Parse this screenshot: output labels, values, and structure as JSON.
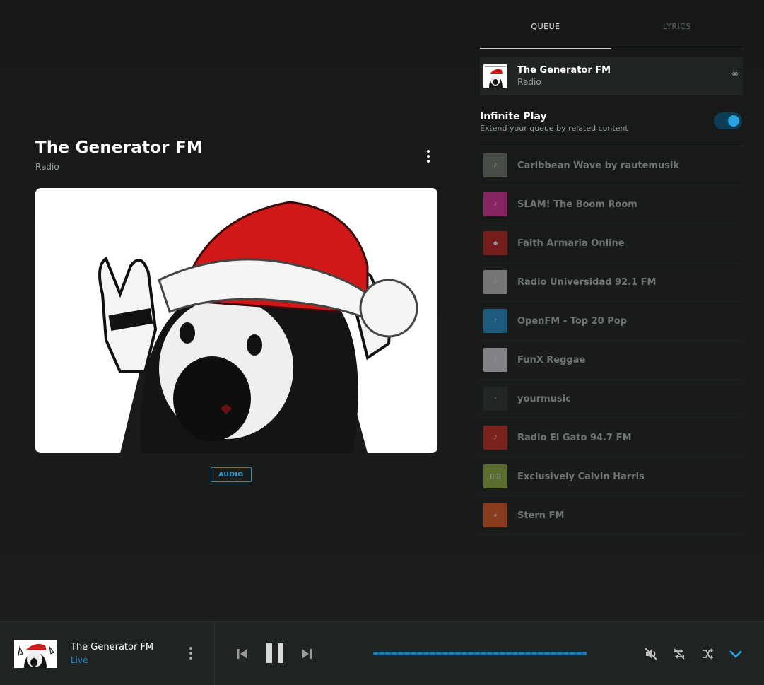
{
  "now_playing": {
    "title": "The Generator FM",
    "subtitle": "Radio",
    "media_badge": "AUDIO"
  },
  "tabs": [
    {
      "label": "QUEUE",
      "active": true
    },
    {
      "label": "LYRICS",
      "active": false
    }
  ],
  "queue_current": {
    "name": "The Generator FM",
    "type": "Radio",
    "repeat_symbol": "∞"
  },
  "infinite_play": {
    "title": "Infinite Play",
    "subtitle": "Extend your queue by related content",
    "enabled": true
  },
  "queue": [
    {
      "name": "Caribbean Wave by rautemusik",
      "thumb_color": "#6d7a6a"
    },
    {
      "name": "SLAM! The Boom Room",
      "thumb_color": "#e0309a"
    },
    {
      "name": "Faith Armaria Online",
      "thumb_color": "#c0201c"
    },
    {
      "name": "Radio Universidad 92.1 FM",
      "thumb_color": "#bfbfbf"
    },
    {
      "name": "OpenFM - Top 20 Pop",
      "thumb_color": "#1f8fd0"
    },
    {
      "name": "FunX Reggae",
      "thumb_color": "#d6d6df"
    },
    {
      "name": "yourmusic",
      "thumb_color": "#2a2d2d"
    },
    {
      "name": "Radio El Gato 94.7 FM",
      "thumb_color": "#c8281c"
    },
    {
      "name": "Exclusively Calvin Harris",
      "thumb_color": "#8fb040"
    },
    {
      "name": "Stern FM",
      "thumb_color": "#e0561c"
    }
  ],
  "player": {
    "title": "The Generator FM",
    "status": "Live"
  },
  "colors": {
    "accent": "#1f8fc9",
    "background": "#161818",
    "bar": "#202323"
  }
}
